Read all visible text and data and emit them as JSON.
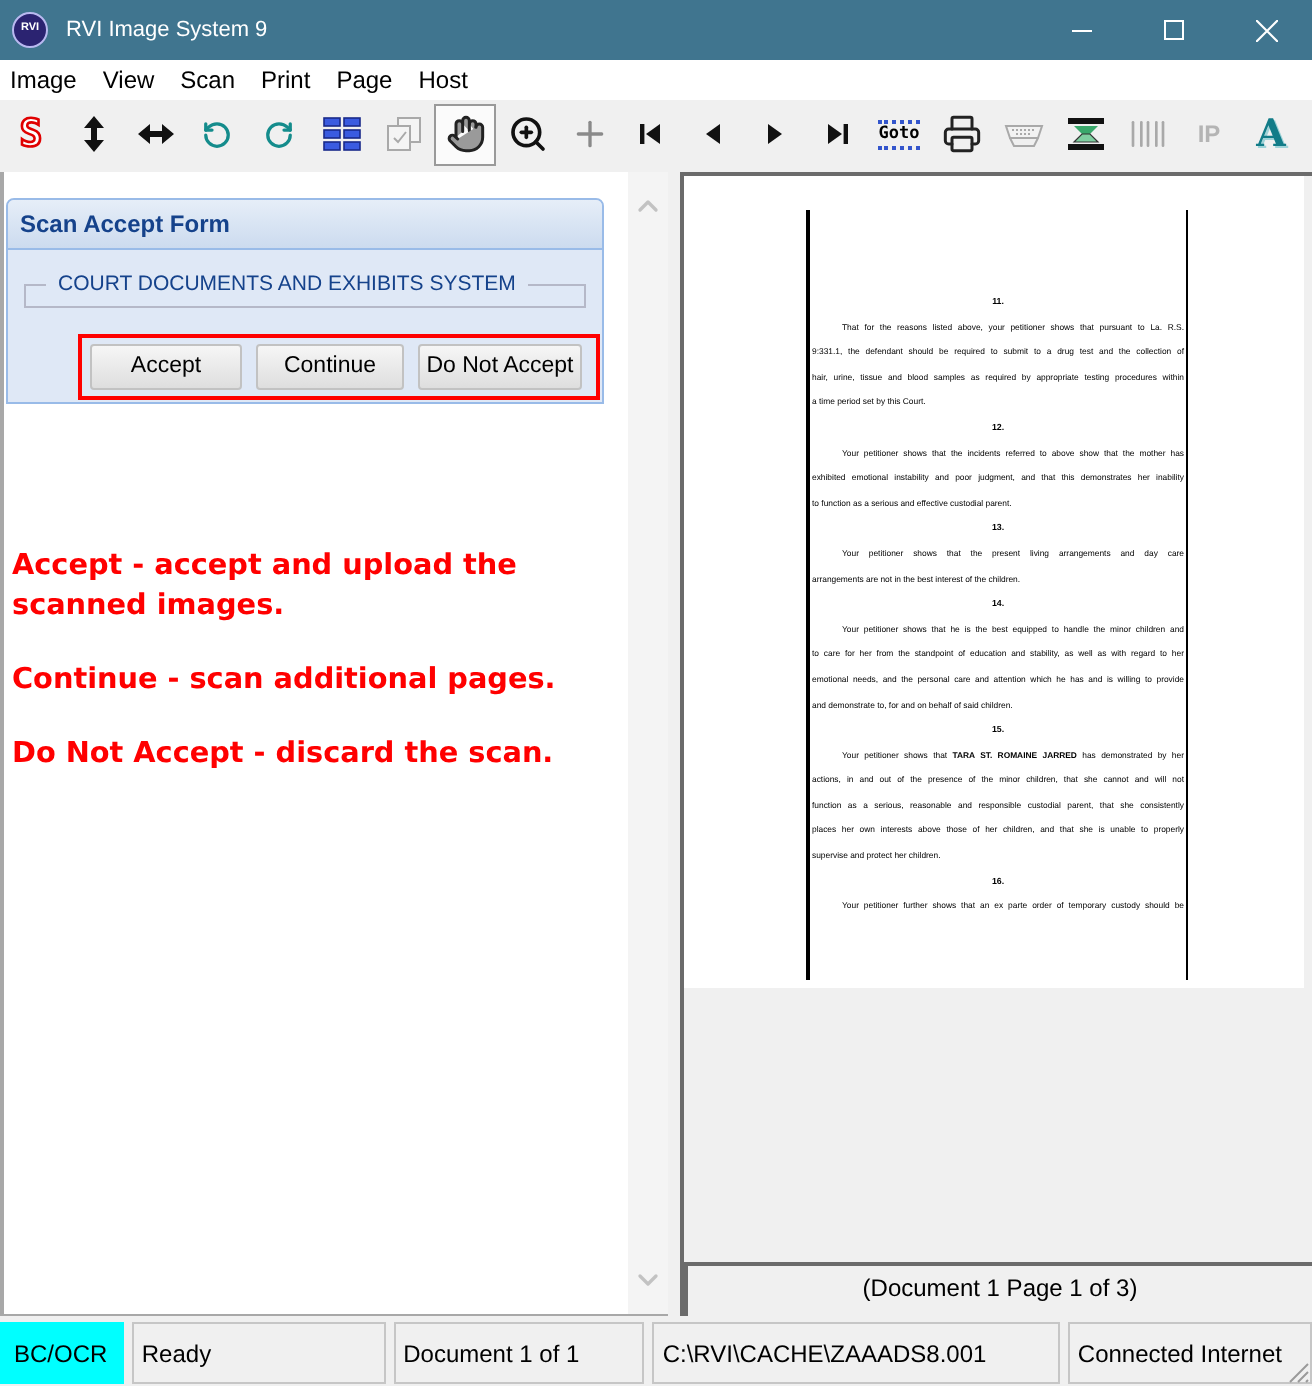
{
  "window": {
    "logo": "RVI",
    "title": "RVI Image System 9"
  },
  "menu": [
    "Image",
    "View",
    "Scan",
    "Print",
    "Page",
    "Host"
  ],
  "toolbar": [
    {
      "label": "S",
      "selected": false,
      "disabled": false
    },
    {
      "selected": false,
      "disabled": false
    },
    {
      "selected": false,
      "disabled": false
    },
    {
      "selected": false,
      "disabled": false
    },
    {
      "selected": false,
      "disabled": false
    },
    {
      "selected": false,
      "disabled": false
    },
    {
      "selected": false,
      "disabled": true
    },
    {
      "selected": true,
      "disabled": false
    },
    {
      "selected": false,
      "disabled": false
    },
    {
      "selected": false,
      "disabled": false
    },
    {
      "selected": false,
      "disabled": false
    },
    {
      "selected": false,
      "disabled": false
    },
    {
      "selected": false,
      "disabled": false
    },
    {
      "selected": false,
      "disabled": false
    },
    {
      "label": "Goto",
      "selected": false,
      "disabled": false
    },
    {
      "selected": false,
      "disabled": false
    },
    {
      "selected": false,
      "disabled": true
    },
    {
      "selected": false,
      "disabled": false
    },
    {
      "selected": false,
      "disabled": true
    },
    {
      "label": "IP",
      "selected": false,
      "disabled": true
    },
    {
      "label": "A",
      "selected": false,
      "disabled": false
    }
  ],
  "form": {
    "title": "Scan Accept Form",
    "group": "COURT DOCUMENTS AND EXHIBITS SYSTEM",
    "highlighted": true,
    "buttons": [
      "Accept",
      "Continue",
      "Do Not Accept"
    ]
  },
  "notes": [
    "Accept - accept and upload the scanned images.",
    "Continue - scan additional pages.",
    "Do Not Accept - discard the scan."
  ],
  "document": {
    "sections": [
      {
        "number": "11.",
        "lines": [
          "That for the reasons listed above, your petitioner shows that pursuant to La. R.S.",
          "9:331.1, the defendant should be required to submit to a drug test and the collection of",
          "hair, urine, tissue and blood samples as required by appropriate testing procedures within",
          "a time period set by this Court."
        ]
      },
      {
        "number": "12.",
        "lines": [
          "Your petitioner shows that the incidents referred to above show that the mother has",
          "exhibited emotional instability and poor judgment, and that this demonstrates her inability",
          "to function as a serious and effective custodial parent."
        ]
      },
      {
        "number": "13.",
        "lines": [
          "Your petitioner shows that the present living arrangements and day care",
          "arrangements are not in the best interest of the children."
        ]
      },
      {
        "number": "14.",
        "lines": [
          "Your petitioner shows that he is the best equipped to handle the minor children and",
          "to care for her from the standpoint of education and stability, as well as with regard to her",
          "emotional needs, and the personal care and attention which he has and is willing to provide",
          "and demonstrate to, for and on behalf of said children."
        ]
      },
      {
        "number": "15.",
        "lines": [
          "Your petitioner shows that **TARA ST. ROMAINE JARRED** has demonstrated by her",
          "actions, in and out of the presence of the minor children, that she cannot and will not",
          "function as a serious, reasonable and responsible custodial parent, that she consistently",
          "places her own interests above those of her children, and that she is unable to properly",
          "supervise and protect her children."
        ]
      },
      {
        "number": "16.",
        "lines": [
          "Your petitioner further shows that an ex parte order of temporary custody should be"
        ]
      }
    ]
  },
  "viewer": {
    "caption": "(Document 1 Page 1 of 3)"
  },
  "status_bar": {
    "mode": {
      "text": "BC/OCR",
      "on": true
    },
    "panels": [
      "Ready",
      "Document 1 of 1",
      "C:\\RVI\\CACHE\\ZAAADS8.001",
      "Connected Internet"
    ]
  }
}
